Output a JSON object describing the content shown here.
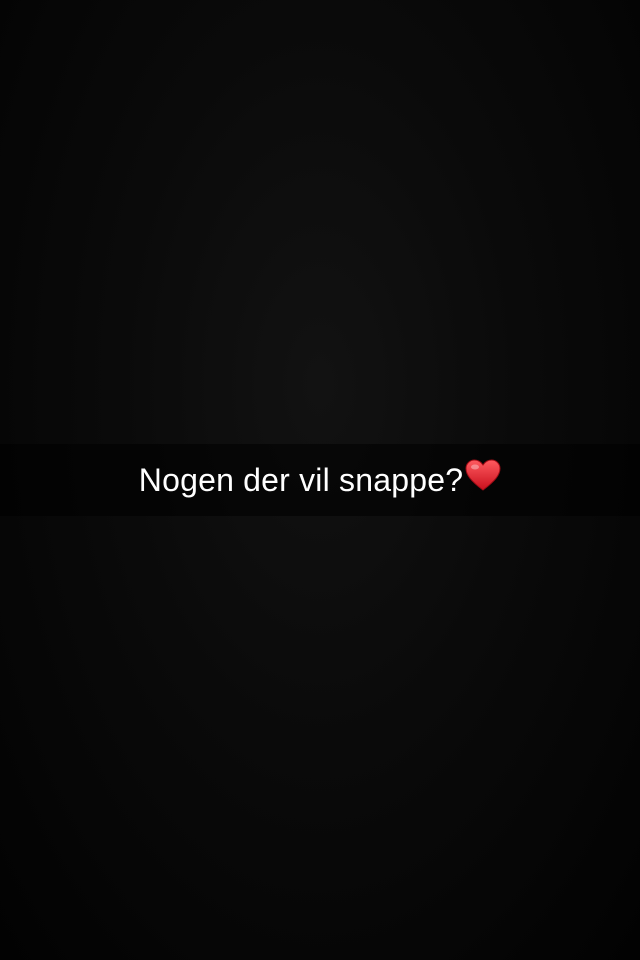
{
  "caption": {
    "text": "Nogen der vil snappe?",
    "emoji": "heart-icon"
  },
  "colors": {
    "background": "#000000",
    "caption_bar": "rgba(0,0,0,0.55)",
    "caption_text": "#ffffff",
    "heart": "#e0242f"
  }
}
